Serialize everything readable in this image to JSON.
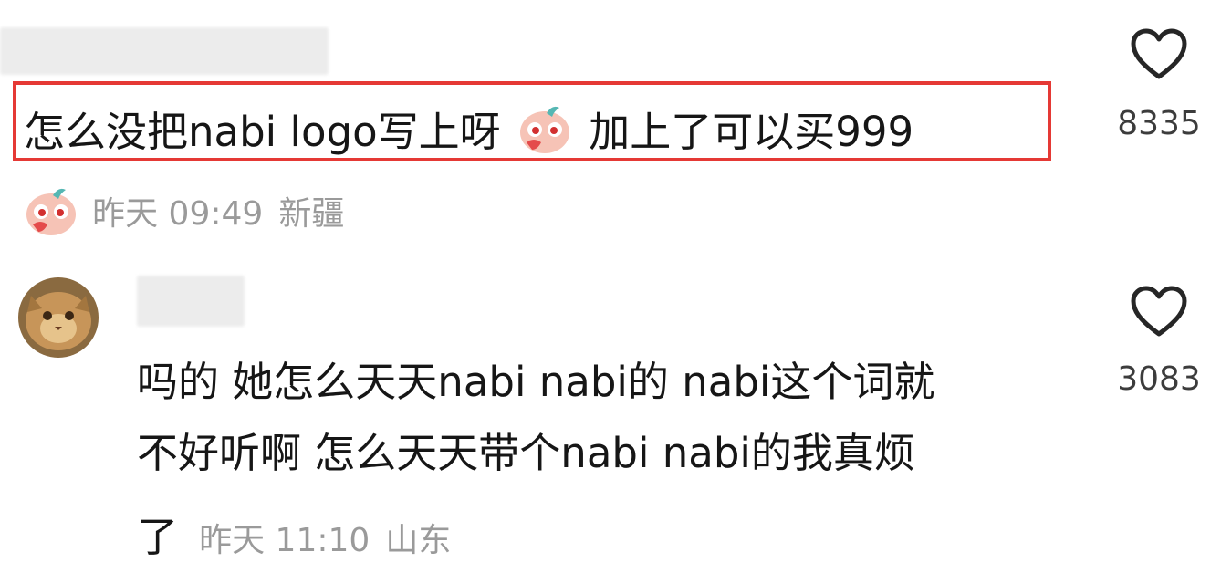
{
  "comments": [
    {
      "text_part1": "怎么没把nabi logo写上呀",
      "text_part2": "加上了可以买999",
      "sticker": "blushing-face-sticker",
      "meta": {
        "time": "昨天 09:49",
        "location": "新疆"
      },
      "like_count": "8335",
      "highlight_color": "#e53935"
    },
    {
      "lines": [
        "吗的 她怎么天天nabi nabi的 nabi这个词就",
        "不好听啊 怎么天天带个nabi nabi的我真烦",
        "了"
      ],
      "meta": {
        "time": "昨天 11:10",
        "location": "山东"
      },
      "like_count": "3083"
    }
  ],
  "icons": {
    "like": "heart-outline-icon",
    "avatar": "cat-avatar"
  }
}
